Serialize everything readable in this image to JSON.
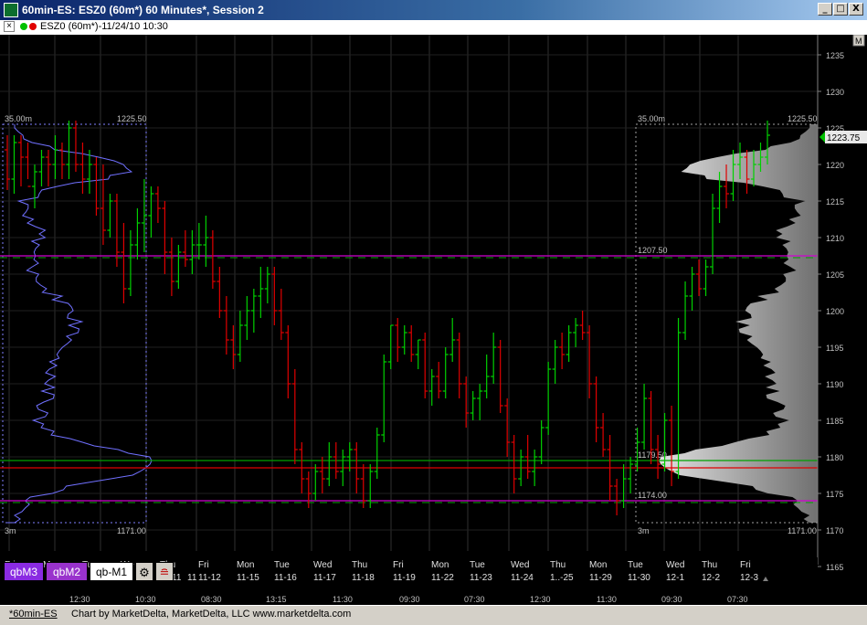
{
  "window": {
    "title": "60min-ES: ESZ0 (60m*) 60 Minutes*, Session 2",
    "min_label": "_",
    "max_label": "□",
    "close_label": "X"
  },
  "infobar": {
    "close_label": "×",
    "text": "ESZ0 (60m*)-11/24/10 10:30",
    "dot_colors": [
      "#00c000",
      "#e00000"
    ]
  },
  "chart_data": {
    "type": "candlestick",
    "y_axis": {
      "min": 1165,
      "max": 1235,
      "ticks": [
        1165,
        1170,
        1175,
        1180,
        1185,
        1190,
        1195,
        1200,
        1205,
        1210,
        1215,
        1220,
        1225,
        1230,
        1235
      ],
      "m_label": "M"
    },
    "last_price": {
      "label": "1223.75",
      "value": 1223.75,
      "color": "#00c000"
    },
    "x_day_labels": [
      {
        "day": "Fri",
        "date": "11-12"
      },
      {
        "day": "Mon",
        "date": "11-15"
      },
      {
        "day": "Tue",
        "date": "11-16"
      },
      {
        "day": "Wed",
        "date": "11-17"
      },
      {
        "day": "Thu",
        "date": "11-18"
      },
      {
        "day": "Fri",
        "date": "11-19"
      },
      {
        "day": "Mon",
        "date": "11-22"
      },
      {
        "day": "Tue",
        "date": "11-23"
      },
      {
        "day": "Wed",
        "date": "11-24"
      },
      {
        "day": "Thu",
        "date": "1..-25"
      },
      {
        "day": "Mon",
        "date": "11-29"
      },
      {
        "day": "Tue",
        "date": "11-30"
      },
      {
        "day": "Wed",
        "date": "12-1"
      },
      {
        "day": "Thu",
        "date": "12-2"
      },
      {
        "day": "Fri",
        "date": "12-3"
      }
    ],
    "x_partial_day_labels": [
      "Fri",
      "Mon",
      "Tue",
      "We",
      "Thu"
    ],
    "x_partial_date_labels": [
      "11",
      "11"
    ],
    "x_time_labels": [
      "12:30",
      "10:30",
      "08:30",
      "13:15",
      "11:30",
      "09:30",
      "07:30",
      "12:30",
      "11:30",
      "09:30",
      "07:30"
    ],
    "left_profile": {
      "top_left_label": "35.00m",
      "top_right_label": "1225.50",
      "bottom_left_label": "3m",
      "bottom_right_label": "1171.00",
      "high": 1225.5,
      "low": 1171.0
    },
    "right_profile": {
      "top_left_label": "35.00m",
      "top_right_label": "1225.50",
      "bottom_left_label": "3m",
      "bottom_right_label": "1171.00",
      "high": 1225.5,
      "low": 1171.0
    },
    "levels": [
      {
        "value": 1207.5,
        "label": "1207.50",
        "color": "#d000d0"
      },
      {
        "value": 1179.5,
        "label": "1179.50",
        "color": "#00a000"
      },
      {
        "value": 1178.5,
        "label": "",
        "color": "#e00000"
      },
      {
        "value": 1174.0,
        "label": "1174.00",
        "color": "#d000d0"
      }
    ],
    "bars": [
      [
        1222,
        1224,
        1216.5,
        1218
      ],
      [
        1218,
        1224,
        1216,
        1223
      ],
      [
        1223,
        1224,
        1217,
        1221
      ],
      [
        1221,
        1223,
        1218,
        1217
      ],
      [
        1217,
        1220,
        1214,
        1219
      ],
      [
        1219,
        1222,
        1217,
        1221
      ],
      [
        1221,
        1222,
        1217,
        1220
      ],
      [
        1220,
        1224,
        1218,
        1222
      ],
      [
        1222,
        1223,
        1218,
        1220
      ],
      [
        1220,
        1226,
        1218,
        1225
      ],
      [
        1225,
        1226,
        1219,
        1220
      ],
      [
        1220,
        1223,
        1216,
        1218
      ],
      [
        1218,
        1222,
        1216,
        1220
      ],
      [
        1220,
        1221,
        1213,
        1214
      ],
      [
        1214,
        1220,
        1209,
        1211
      ],
      [
        1211,
        1216,
        1210,
        1215
      ],
      [
        1215,
        1216,
        1206,
        1208
      ],
      [
        1208,
        1212,
        1201,
        1203
      ],
      [
        1203,
        1211,
        1202,
        1209
      ],
      [
        1209,
        1214,
        1207,
        1212
      ],
      [
        1212,
        1218,
        1208,
        1213
      ],
      [
        1213,
        1217,
        1210,
        1216
      ],
      [
        1216,
        1217,
        1212,
        1214
      ],
      [
        1214,
        1215,
        1205,
        1208
      ],
      [
        1208,
        1210,
        1202,
        1204
      ],
      [
        1204,
        1209,
        1203,
        1208
      ],
      [
        1208,
        1211,
        1206,
        1207
      ],
      [
        1207,
        1211,
        1205,
        1209
      ],
      [
        1209,
        1212,
        1207,
        1209
      ],
      [
        1209,
        1213,
        1206,
        1210
      ],
      [
        1210,
        1211,
        1203,
        1204
      ],
      [
        1204,
        1206,
        1199,
        1200
      ],
      [
        1200,
        1202,
        1194,
        1196
      ],
      [
        1196,
        1198,
        1192,
        1194
      ],
      [
        1194,
        1200,
        1193,
        1198
      ],
      [
        1198,
        1202,
        1196,
        1200
      ],
      [
        1200,
        1203,
        1197,
        1202
      ],
      [
        1202,
        1206,
        1199,
        1203
      ],
      [
        1203,
        1206,
        1201,
        1205
      ],
      [
        1205,
        1206,
        1198,
        1200
      ],
      [
        1200,
        1203,
        1196,
        1197
      ],
      [
        1197,
        1198,
        1188,
        1190
      ],
      [
        1190,
        1192,
        1179,
        1181
      ],
      [
        1181,
        1182,
        1175,
        1177
      ],
      [
        1177,
        1178,
        1173,
        1175
      ],
      [
        1175,
        1179,
        1174,
        1178
      ],
      [
        1178,
        1180,
        1175,
        1177
      ],
      [
        1177,
        1182,
        1176,
        1180
      ],
      [
        1180,
        1182,
        1177,
        1178
      ],
      [
        1178,
        1181,
        1176,
        1180
      ],
      [
        1180,
        1182,
        1178,
        1181
      ],
      [
        1181,
        1182,
        1175,
        1177
      ],
      [
        1177,
        1179,
        1173,
        1174
      ],
      [
        1174,
        1179,
        1173,
        1178
      ],
      [
        1178,
        1184,
        1177,
        1183
      ],
      [
        1183,
        1194,
        1182,
        1193
      ],
      [
        1193,
        1198,
        1192,
        1198
      ],
      [
        1198,
        1199,
        1193,
        1195
      ],
      [
        1195,
        1198,
        1194,
        1197
      ],
      [
        1197,
        1198,
        1193,
        1194
      ],
      [
        1194,
        1196,
        1192,
        1196
      ],
      [
        1196,
        1197,
        1188,
        1189
      ],
      [
        1189,
        1192,
        1187,
        1191
      ],
      [
        1191,
        1193,
        1188,
        1189
      ],
      [
        1189,
        1195,
        1188,
        1194
      ],
      [
        1194,
        1199,
        1193,
        1196
      ],
      [
        1196,
        1197,
        1188,
        1190
      ],
      [
        1190,
        1191,
        1184,
        1186
      ],
      [
        1186,
        1189,
        1185,
        1188
      ],
      [
        1188,
        1190,
        1185,
        1189
      ],
      [
        1189,
        1194,
        1188,
        1191
      ],
      [
        1191,
        1197,
        1190,
        1195
      ],
      [
        1195,
        1196,
        1186,
        1187
      ],
      [
        1187,
        1188,
        1180,
        1182
      ],
      [
        1182,
        1183,
        1175,
        1177
      ],
      [
        1177,
        1181,
        1176,
        1180
      ],
      [
        1180,
        1183,
        1177,
        1178
      ],
      [
        1178,
        1181,
        1176,
        1180
      ],
      [
        1180,
        1185,
        1179,
        1184
      ],
      [
        1184,
        1193,
        1183,
        1192
      ],
      [
        1192,
        1196,
        1190,
        1195
      ],
      [
        1195,
        1197,
        1192,
        1194
      ],
      [
        1194,
        1198,
        1193,
        1197
      ],
      [
        1197,
        1199,
        1195,
        1198
      ],
      [
        1198,
        1200,
        1196,
        1197
      ],
      [
        1197,
        1198,
        1188,
        1190
      ],
      [
        1190,
        1191,
        1182,
        1184
      ],
      [
        1184,
        1186,
        1180,
        1181
      ],
      [
        1181,
        1183,
        1174,
        1176
      ],
      [
        1176,
        1177,
        1172,
        1174
      ],
      [
        1174,
        1179,
        1173,
        1177
      ],
      [
        1177,
        1180,
        1175,
        1179
      ],
      [
        1179,
        1184,
        1178,
        1182
      ],
      [
        1182,
        1190,
        1181,
        1188
      ],
      [
        1188,
        1189,
        1179,
        1181
      ],
      [
        1181,
        1183,
        1177,
        1179
      ],
      [
        1179,
        1186,
        1178,
        1185
      ],
      [
        1185,
        1187,
        1176,
        1178
      ],
      [
        1178,
        1199,
        1177,
        1197
      ],
      [
        1197,
        1204,
        1196,
        1202
      ],
      [
        1202,
        1206,
        1200,
        1205
      ],
      [
        1205,
        1207,
        1202,
        1203
      ],
      [
        1203,
        1207,
        1202,
        1206
      ],
      [
        1206,
        1216,
        1205,
        1214
      ],
      [
        1214,
        1219,
        1212,
        1217
      ],
      [
        1217,
        1220,
        1214,
        1216
      ],
      [
        1216,
        1222,
        1215,
        1220
      ],
      [
        1220,
        1223,
        1218,
        1221
      ],
      [
        1221,
        1222,
        1216,
        1218
      ],
      [
        1218,
        1222,
        1217,
        1220
      ],
      [
        1220,
        1223,
        1219,
        1221
      ],
      [
        1221,
        1226,
        1220,
        1224
      ]
    ]
  },
  "tabs": [
    {
      "label": "qbM3",
      "bg": "#8a2be2",
      "fg": "#ffffff"
    },
    {
      "label": "qbM2",
      "bg": "#9932cc",
      "fg": "#ffffff"
    },
    {
      "label": "qb-M1",
      "bg": "#ffffff",
      "fg": "#000000"
    }
  ],
  "status": {
    "chart_name": "*60min-ES",
    "credit": "Chart by MarketDelta, MarketDelta, LLC www.marketdelta.com"
  }
}
